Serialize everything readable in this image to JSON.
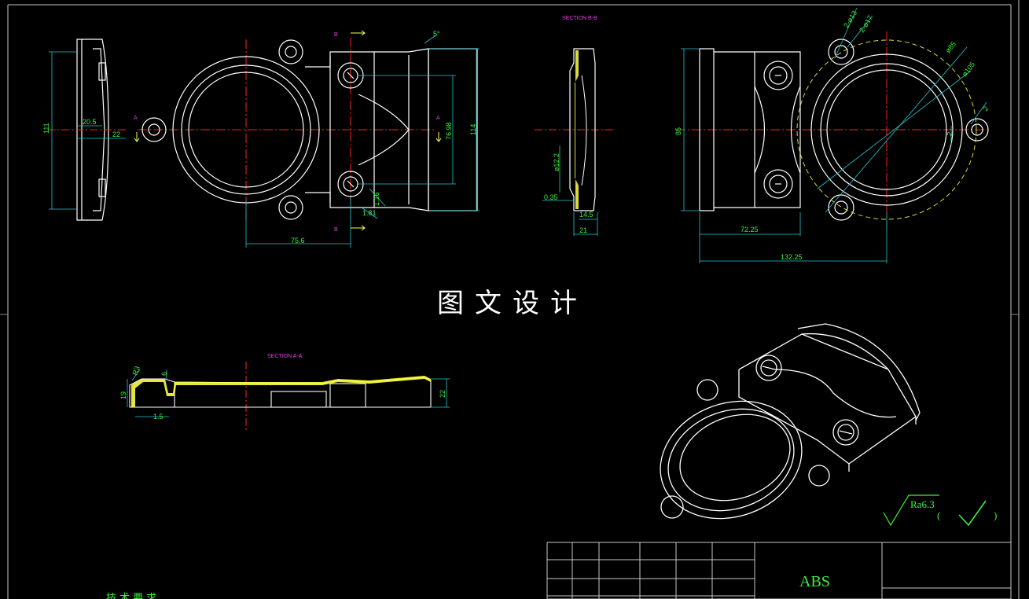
{
  "title_watermark": "图文设计",
  "section_labels": {
    "section_bb": "SECTION B-B",
    "section_aa": "SECTION A-A",
    "cut_a": "A",
    "cut_b": "B"
  },
  "dimensions": {
    "side_view": {
      "height": "111",
      "depth": "20.5",
      "offset": "22"
    },
    "top_view": {
      "width_lower": "75.6",
      "height_right": "114",
      "inner": "76.98",
      "small_1": "1.81",
      "small_2": "1.16",
      "angle": "5°"
    },
    "section_bb": {
      "dia": "ø12.2",
      "thk": "0.35",
      "w1": "14.5",
      "w2": "21"
    },
    "right_view": {
      "h": "85",
      "w1": "72.25",
      "w2": "132.25",
      "d1": "2-ø13",
      "d2": "2-ø17",
      "d3": "ø85",
      "d4": "ø105",
      "r1": "2",
      "r2": "2"
    },
    "section_aa": {
      "r": "R3",
      "w": "6",
      "h1": "19",
      "b": "1.5",
      "h2": "22"
    }
  },
  "surface_finish": {
    "label": "Ra6.3"
  },
  "title_block": {
    "material": "ABS"
  },
  "tech_requirements": {
    "label": "技术要求"
  },
  "colors": {
    "background": "#000000",
    "geometry": "#ffffff",
    "dimension": "#3cf03c",
    "centerline": "#ff2020",
    "hidden_cyan": "#25c6cf",
    "section_fill": "#ffff44",
    "label_magenta": "#e040e0",
    "frame": "#c8c8c8"
  }
}
